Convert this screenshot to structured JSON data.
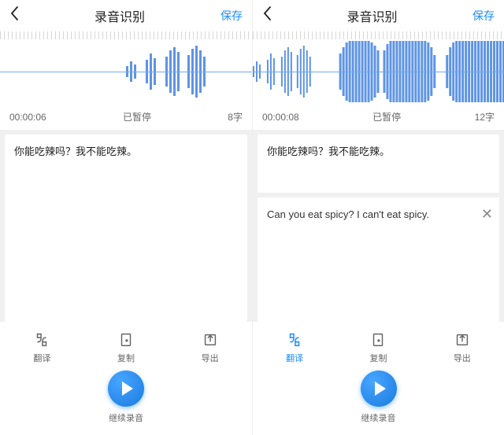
{
  "left": {
    "header": {
      "title": "录音识别",
      "save": "保存"
    },
    "status": {
      "time": "00:00:06",
      "state": "已暂停",
      "chars": "8字"
    },
    "text": "你能吃辣吗？我不能吃辣。",
    "actions": {
      "translate": "翻译",
      "copy": "复制",
      "export": "导出"
    },
    "continue": "继续录音"
  },
  "right": {
    "header": {
      "title": "录音识别",
      "save": "保存"
    },
    "status": {
      "time": "00:00:08",
      "state": "已暂停",
      "chars": "12字"
    },
    "text": "你能吃辣吗？我不能吃辣。",
    "translation": "Can you eat spicy? I can't eat spicy.",
    "actions": {
      "translate": "翻译",
      "copy": "复制",
      "export": "导出"
    },
    "continue": "继续录音"
  },
  "colors": {
    "accent": "#1a8cff"
  }
}
